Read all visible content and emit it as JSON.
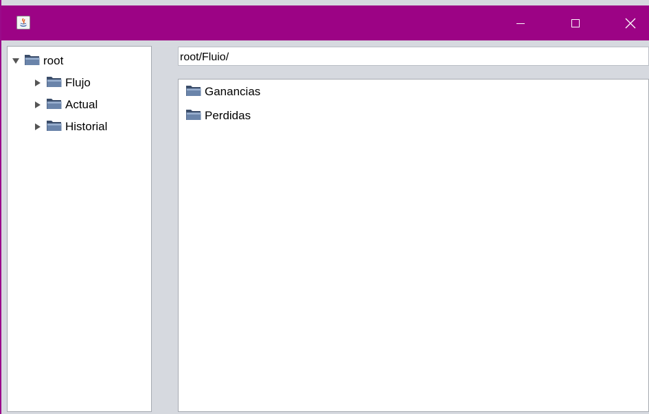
{
  "window": {
    "app_icon": "java-icon",
    "accent_color": "#9c0385"
  },
  "tree": {
    "root": {
      "label": "root",
      "expanded": true
    },
    "children": [
      {
        "label": "Flujo",
        "expanded": false
      },
      {
        "label": "Actual",
        "expanded": false
      },
      {
        "label": "Historial",
        "expanded": false
      }
    ]
  },
  "path": {
    "value": "root/Fluio/"
  },
  "list": {
    "items": [
      {
        "label": "Ganancias",
        "icon": "folder-icon"
      },
      {
        "label": "Perdidas",
        "icon": "folder-icon"
      }
    ]
  }
}
